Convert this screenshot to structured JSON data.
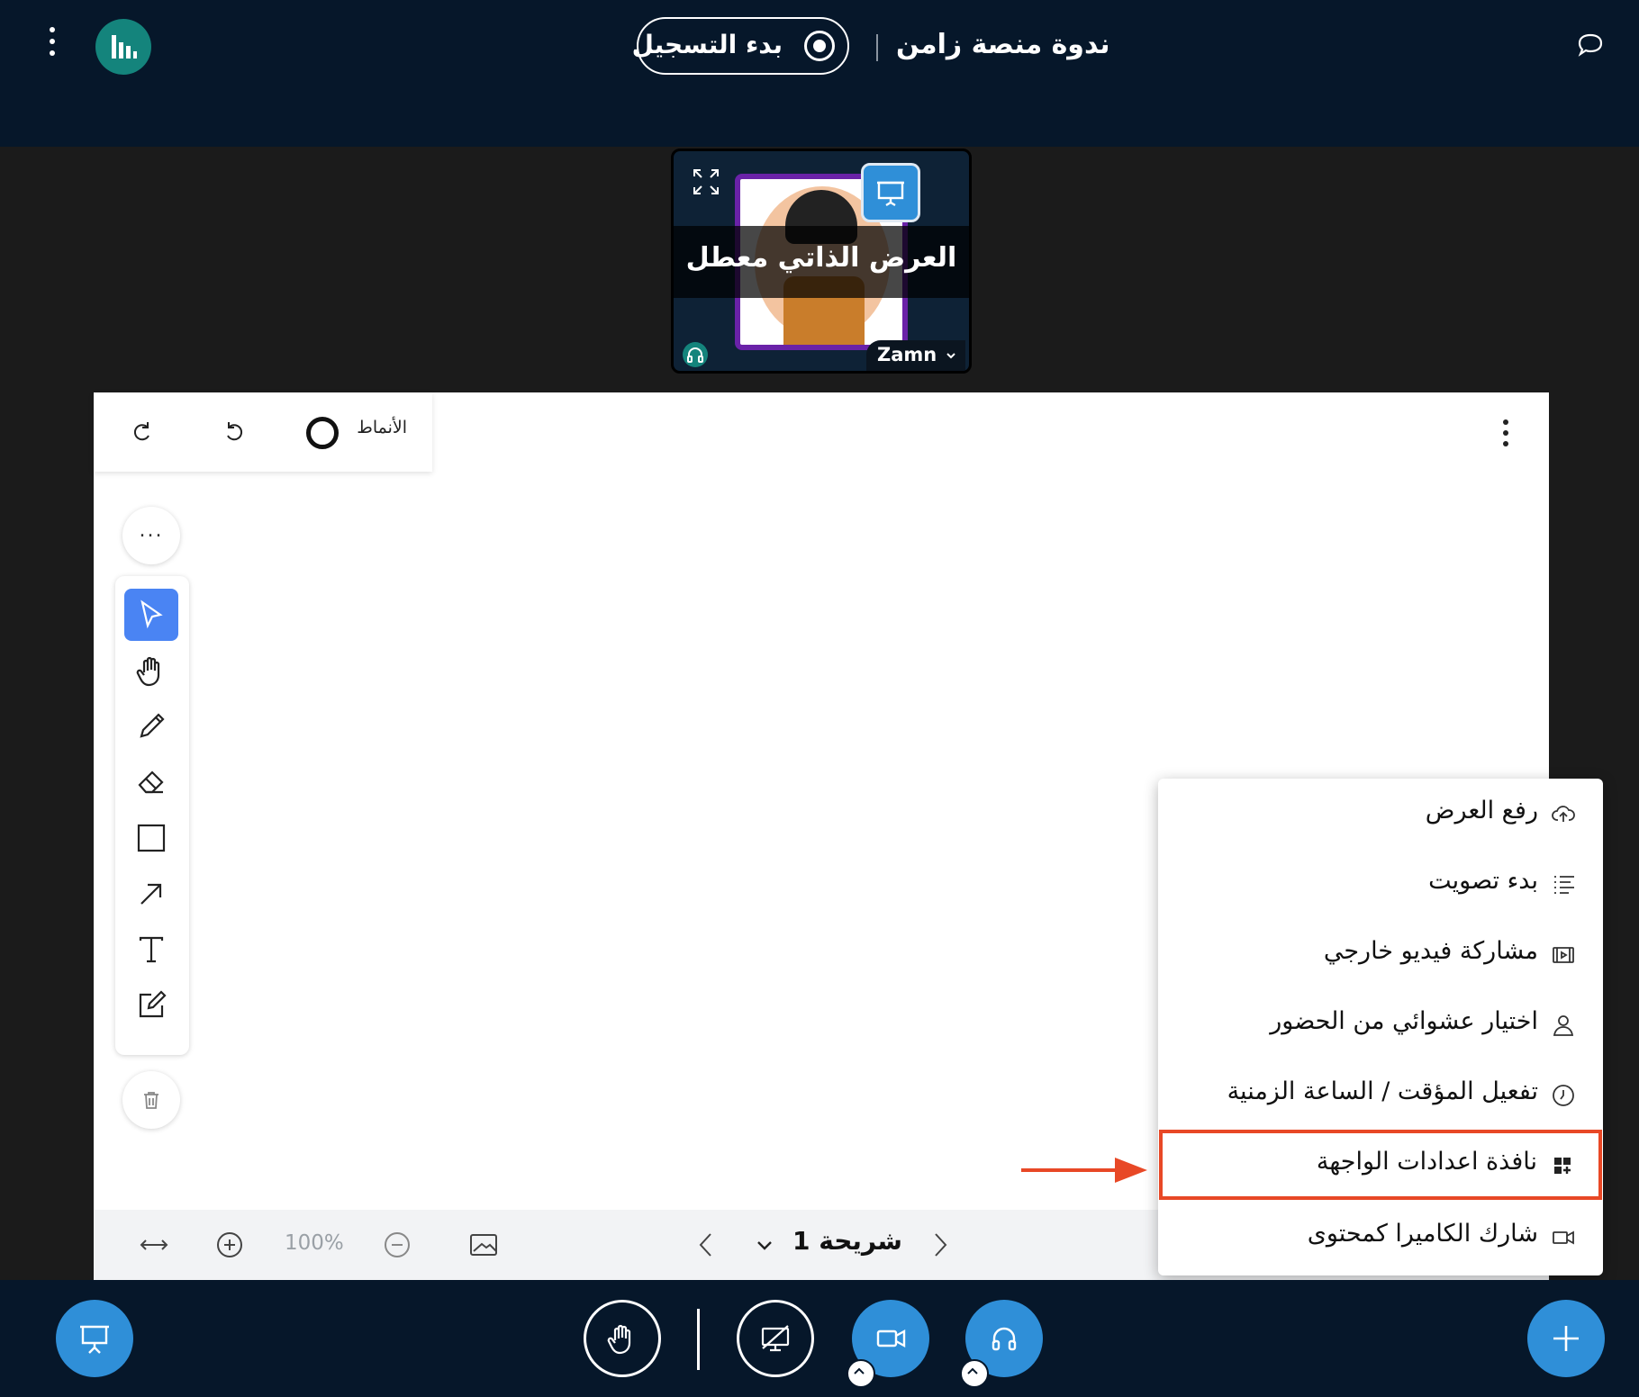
{
  "header": {
    "record_label": "بدء التسجيل",
    "meeting_title": "ندوة منصة زامن"
  },
  "webcam": {
    "overlay_text": "العرض الذاتي معطل",
    "user_name": "Zamn"
  },
  "whiteboard": {
    "styles_label": "الأنماط",
    "more_label": "...",
    "zoom_level": "100%",
    "slide_label": "شريحة 1"
  },
  "actions_menu": {
    "items": [
      {
        "label": "رفع العرض",
        "icon": "upload-cloud-icon"
      },
      {
        "label": "بدء تصويت",
        "icon": "poll-list-icon"
      },
      {
        "label": "مشاركة فيديو خارجي",
        "icon": "video-film-icon"
      },
      {
        "label": "اختيار عشوائي من الحضور",
        "icon": "user-icon"
      },
      {
        "label": "تفعيل المؤقت / الساعة الزمنية",
        "icon": "clock-icon"
      },
      {
        "label": "نافذة اعدادات الواجهة",
        "icon": "layout-grid-icon"
      },
      {
        "label": "شارك الكاميرا كمحتوى",
        "icon": "camera-icon"
      }
    ]
  },
  "colors": {
    "header_bg": "#06172a",
    "accent_blue": "#2f8fd8",
    "highlight_red": "#e84826",
    "logo_teal": "#14847c"
  }
}
